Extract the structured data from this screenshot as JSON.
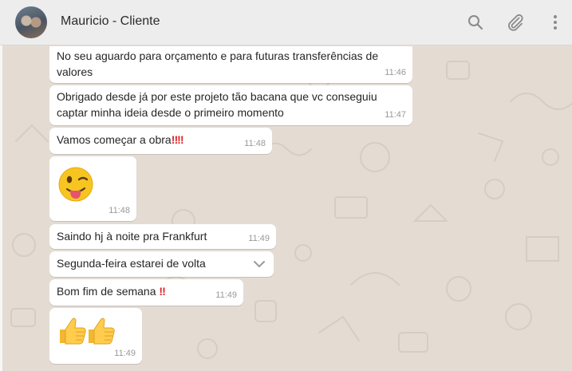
{
  "header": {
    "contact_name": "Mauricio - Cliente",
    "icons": [
      "search-icon",
      "attach-icon",
      "menu-icon"
    ]
  },
  "messages": [
    {
      "line1": "No seu aguardo para orçamento e para futuras transferências de",
      "line2": "valores",
      "time": "11:46"
    },
    {
      "line1": "Obrigado desde já por este projeto tão bacana que vc conseguiu",
      "line2": "captar minha ideia desde o primeiro momento",
      "time": "11:47"
    },
    {
      "text": "Vamos começar a obra",
      "suffix": "‼‼",
      "time": "11:48"
    },
    {
      "emoji": "winking-face-tongue-emoji",
      "time": "11:48"
    },
    {
      "text": "Saindo hj à noite pra Frankfurt",
      "time": "11:49"
    },
    {
      "text": "Segunda-feira estarei de volta",
      "time": ""
    },
    {
      "text": "Bom fim de semana",
      "suffix": "‼",
      "time": "11:49"
    },
    {
      "emoji": "thumbs-up-emoji",
      "time": "11:49"
    }
  ],
  "colors": {
    "chat_background": "#e4dcd3",
    "bubble": "#ffffff",
    "header": "#ededed",
    "exclamation": "#e0242a"
  }
}
